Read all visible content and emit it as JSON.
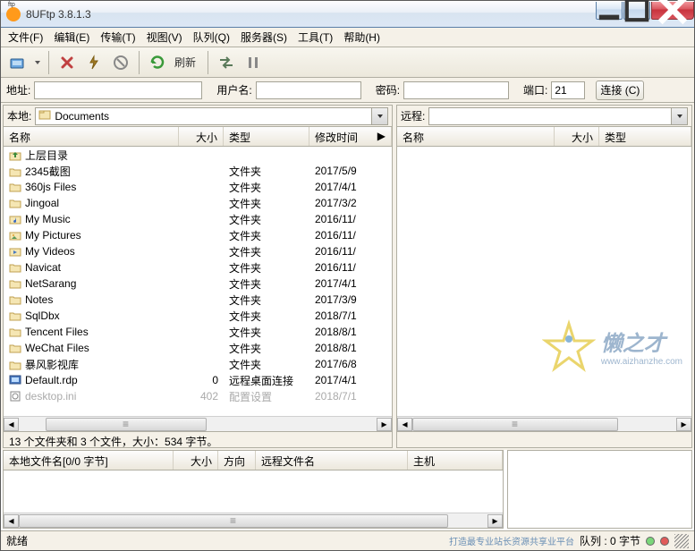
{
  "title": "8UFtp 3.8.1.3",
  "menu": {
    "file": "文件(F)",
    "edit": "编辑(E)",
    "transfer": "传输(T)",
    "view": "视图(V)",
    "queue": "队列(Q)",
    "server": "服务器(S)",
    "tools": "工具(T)",
    "help": "帮助(H)"
  },
  "toolbar": {
    "refresh": "刷新"
  },
  "conn": {
    "addr": "地址:",
    "user": "用户名:",
    "pass": "密码:",
    "port": "端口:",
    "port_val": "21",
    "connect": "连接 (C)"
  },
  "left": {
    "label": "本地:",
    "path": "Documents",
    "cols": {
      "name": "名称",
      "size": "大小",
      "type": "类型",
      "mtime": "修改时间"
    },
    "status": "13 个文件夹和 3 个文件，大小：534 字节。",
    "rows": [
      {
        "icon": "up",
        "name": "上层目录",
        "size": "",
        "type": "",
        "mtime": ""
      },
      {
        "icon": "folder",
        "name": "2345截图",
        "size": "",
        "type": "文件夹",
        "mtime": "2017/5/9"
      },
      {
        "icon": "folder",
        "name": "360js Files",
        "size": "",
        "type": "文件夹",
        "mtime": "2017/4/1"
      },
      {
        "icon": "folder",
        "name": "Jingoal",
        "size": "",
        "type": "文件夹",
        "mtime": "2017/3/2"
      },
      {
        "icon": "music",
        "name": "My Music",
        "size": "",
        "type": "文件夹",
        "mtime": "2016/11/"
      },
      {
        "icon": "pics",
        "name": "My Pictures",
        "size": "",
        "type": "文件夹",
        "mtime": "2016/11/"
      },
      {
        "icon": "video",
        "name": "My Videos",
        "size": "",
        "type": "文件夹",
        "mtime": "2016/11/"
      },
      {
        "icon": "folder",
        "name": "Navicat",
        "size": "",
        "type": "文件夹",
        "mtime": "2016/11/"
      },
      {
        "icon": "folder",
        "name": "NetSarang",
        "size": "",
        "type": "文件夹",
        "mtime": "2017/4/1"
      },
      {
        "icon": "folder",
        "name": "Notes",
        "size": "",
        "type": "文件夹",
        "mtime": "2017/3/9"
      },
      {
        "icon": "folder",
        "name": "SqlDbx",
        "size": "",
        "type": "文件夹",
        "mtime": "2018/7/1"
      },
      {
        "icon": "folder",
        "name": "Tencent Files",
        "size": "",
        "type": "文件夹",
        "mtime": "2018/8/1"
      },
      {
        "icon": "folder",
        "name": "WeChat Files",
        "size": "",
        "type": "文件夹",
        "mtime": "2018/8/1"
      },
      {
        "icon": "folder",
        "name": "暴风影视库",
        "size": "",
        "type": "文件夹",
        "mtime": "2017/6/8"
      },
      {
        "icon": "rdp",
        "name": "Default.rdp",
        "size": "0",
        "type": "远程桌面连接",
        "mtime": "2017/4/1"
      },
      {
        "icon": "ini",
        "name": "desktop.ini",
        "size": "402",
        "type": "配置设置",
        "mtime": "2018/7/1"
      }
    ]
  },
  "right": {
    "label": "远程:",
    "cols": {
      "name": "名称",
      "size": "大小",
      "type": "类型"
    }
  },
  "queuecols": {
    "local": "本地文件名[0/0 字节]",
    "size": "大小",
    "dir": "方向",
    "remote": "远程文件名",
    "host": "主机"
  },
  "status": {
    "ready": "就绪",
    "queue": "队列 : 0 字节",
    "footer": "打造最专业站长资源共享业平台"
  },
  "wm": {
    "txt": "懒之才",
    "url": "www.aizhanzhe.com"
  }
}
